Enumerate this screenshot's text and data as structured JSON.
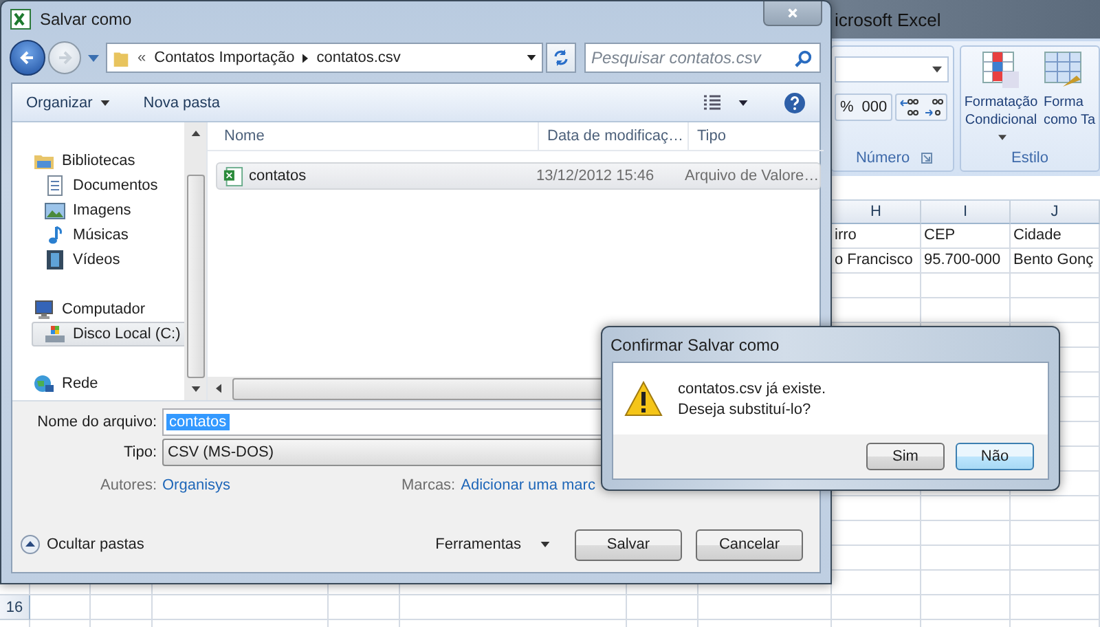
{
  "excel": {
    "title": "icrosoft Excel",
    "ribbon": {
      "number_buttons": [
        "%",
        "000"
      ],
      "number_group": "Número",
      "style_buttons": [
        {
          "label": "Formatação Condicional",
          "dropdown": true
        },
        {
          "label": "Forma como Ta",
          "dropdown": false
        }
      ],
      "style_group": "Estilo"
    },
    "sheet": {
      "columns": [
        "H",
        "I",
        "J"
      ],
      "row_headers": [
        "16"
      ],
      "rows": [
        [
          "irro",
          "CEP",
          "Cidade"
        ],
        [
          "o Francisco",
          "95.700-000",
          "Bento Gonç"
        ]
      ]
    }
  },
  "save_dialog": {
    "title": "Salvar como",
    "address_overflow": "«",
    "address": [
      "Contatos Importação",
      "contatos.csv"
    ],
    "search": {
      "placeholder": "Pesquisar contatos.csv"
    },
    "toolbar": [
      {
        "label": "Organizar",
        "dropdown": true
      },
      {
        "label": "Nova pasta",
        "dropdown": false
      }
    ],
    "nav": [
      {
        "label": "Bibliotecas",
        "kind": "library",
        "selected": false,
        "children": [
          {
            "label": "Documentos",
            "kind": "document",
            "selected": false
          },
          {
            "label": "Imagens",
            "kind": "image",
            "selected": false
          },
          {
            "label": "Músicas",
            "kind": "music",
            "selected": false
          },
          {
            "label": "Vídeos",
            "kind": "video",
            "selected": false
          }
        ]
      },
      {
        "label": "Computador",
        "kind": "computer",
        "selected": false,
        "children": [
          {
            "label": "Disco Local (C:)",
            "kind": "drive",
            "selected": true
          }
        ]
      },
      {
        "label": "Rede",
        "kind": "network",
        "selected": false
      }
    ],
    "columns": [
      "Nome",
      "Data de modificaç…",
      "Tipo"
    ],
    "files": [
      {
        "name": "contatos",
        "date": "13/12/2012 15:46",
        "type": "Arquivo de Valore…",
        "selected": true
      }
    ],
    "filename": {
      "label": "Nome do arquivo:",
      "value": "contatos"
    },
    "type": {
      "label": "Tipo:",
      "value": "CSV (MS-DOS)"
    },
    "authors": {
      "label": "Autores:",
      "value": "Organisys"
    },
    "tags": {
      "label": "Marcas:",
      "value": "Adicionar uma marc"
    },
    "hide_folders": "Ocultar pastas",
    "tools": "Ferramentas",
    "buttons": [
      "Salvar",
      "Cancelar"
    ]
  },
  "confirm_dialog": {
    "title": "Confirmar Salvar como",
    "message": [
      "contatos.csv já existe.",
      "Deseja substituí-lo?"
    ],
    "buttons": [
      {
        "label": "Sim",
        "focused": false
      },
      {
        "label": "Não",
        "focused": true
      }
    ]
  }
}
